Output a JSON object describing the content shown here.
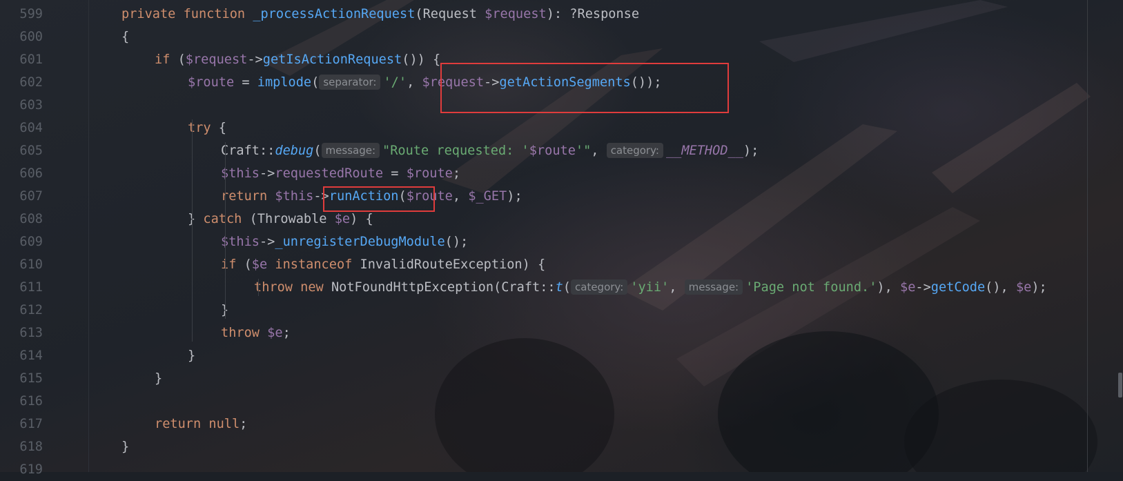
{
  "editor": {
    "lines": [
      {
        "n": "599",
        "indent": 1,
        "tokens": [
          {
            "t": "private ",
            "c": "kw"
          },
          {
            "t": "function ",
            "c": "kw"
          },
          {
            "t": "_processActionRequest",
            "c": "fn"
          },
          {
            "t": "(Request ",
            "c": ""
          },
          {
            "t": "$request",
            "c": "var"
          },
          {
            "t": "): ?Response",
            "c": ""
          }
        ]
      },
      {
        "n": "600",
        "indent": 1,
        "tokens": [
          {
            "t": "{",
            "c": ""
          }
        ]
      },
      {
        "n": "601",
        "indent": 2,
        "tokens": [
          {
            "t": "if ",
            "c": "kw"
          },
          {
            "t": "(",
            "c": ""
          },
          {
            "t": "$request",
            "c": "var"
          },
          {
            "t": "->",
            "c": ""
          },
          {
            "t": "getIsActionRequest",
            "c": "fn"
          },
          {
            "t": "()) {",
            "c": ""
          }
        ]
      },
      {
        "n": "602",
        "indent": 3,
        "tokens": [
          {
            "t": "$route",
            "c": "var"
          },
          {
            "t": " = ",
            "c": ""
          },
          {
            "t": "implode",
            "c": "fn"
          },
          {
            "t": "(",
            "c": ""
          },
          {
            "hint": "separator:"
          },
          {
            "t": "'/'",
            "c": "str"
          },
          {
            "t": ", ",
            "c": ""
          },
          {
            "t": "$request",
            "c": "var"
          },
          {
            "t": "->",
            "c": ""
          },
          {
            "t": "getActionSegments",
            "c": "fn"
          },
          {
            "t": "());",
            "c": ""
          }
        ]
      },
      {
        "n": "603",
        "indent": 0,
        "tokens": []
      },
      {
        "n": "604",
        "indent": 3,
        "tokens": [
          {
            "t": "try ",
            "c": "kw"
          },
          {
            "t": "{",
            "c": ""
          }
        ]
      },
      {
        "n": "605",
        "indent": 4,
        "tokens": [
          {
            "t": "Craft::",
            "c": ""
          },
          {
            "t": "debug",
            "c": "fn it"
          },
          {
            "t": "(",
            "c": ""
          },
          {
            "hint": "message:"
          },
          {
            "t": "\"Route requested: '",
            "c": "str"
          },
          {
            "t": "$route",
            "c": "var"
          },
          {
            "t": "'\"",
            "c": "str"
          },
          {
            "t": ", ",
            "c": ""
          },
          {
            "hint": "category:"
          },
          {
            "t": "__METHOD__",
            "c": "var it"
          },
          {
            "t": ");",
            "c": ""
          }
        ]
      },
      {
        "n": "606",
        "indent": 4,
        "tokens": [
          {
            "t": "$this",
            "c": "var"
          },
          {
            "t": "->",
            "c": ""
          },
          {
            "t": "requestedRoute",
            "c": "var"
          },
          {
            "t": " = ",
            "c": ""
          },
          {
            "t": "$route",
            "c": "var"
          },
          {
            "t": ";",
            "c": ""
          }
        ]
      },
      {
        "n": "607",
        "indent": 4,
        "tokens": [
          {
            "t": "return ",
            "c": "kw"
          },
          {
            "t": "$this",
            "c": "var"
          },
          {
            "t": "->",
            "c": ""
          },
          {
            "t": "runAction",
            "c": "fn"
          },
          {
            "t": "(",
            "c": ""
          },
          {
            "t": "$route",
            "c": "var"
          },
          {
            "t": ", ",
            "c": ""
          },
          {
            "t": "$_GET",
            "c": "var"
          },
          {
            "t": ");",
            "c": ""
          }
        ]
      },
      {
        "n": "608",
        "indent": 3,
        "tokens": [
          {
            "t": "} ",
            "c": ""
          },
          {
            "t": "catch ",
            "c": "kw"
          },
          {
            "t": "(Throwable ",
            "c": ""
          },
          {
            "t": "$e",
            "c": "var"
          },
          {
            "t": ") {",
            "c": ""
          }
        ]
      },
      {
        "n": "609",
        "indent": 4,
        "tokens": [
          {
            "t": "$this",
            "c": "var"
          },
          {
            "t": "->",
            "c": ""
          },
          {
            "t": "_unregisterDebugModule",
            "c": "fn"
          },
          {
            "t": "();",
            "c": ""
          }
        ]
      },
      {
        "n": "610",
        "indent": 4,
        "tokens": [
          {
            "t": "if ",
            "c": "kw"
          },
          {
            "t": "(",
            "c": ""
          },
          {
            "t": "$e ",
            "c": "var"
          },
          {
            "t": "instanceof ",
            "c": "kw"
          },
          {
            "t": "InvalidRouteException) {",
            "c": ""
          }
        ]
      },
      {
        "n": "611",
        "indent": 5,
        "tokens": [
          {
            "t": "throw ",
            "c": "kw"
          },
          {
            "t": "new ",
            "c": "kw"
          },
          {
            "t": "NotFoundHttpException(Craft::",
            "c": ""
          },
          {
            "t": "t",
            "c": "fn it"
          },
          {
            "t": "(",
            "c": ""
          },
          {
            "hint": "category:"
          },
          {
            "t": "'yii'",
            "c": "str"
          },
          {
            "t": ", ",
            "c": ""
          },
          {
            "hint": "message:"
          },
          {
            "t": "'Page not found.'",
            "c": "str"
          },
          {
            "t": "), ",
            "c": ""
          },
          {
            "t": "$e",
            "c": "var"
          },
          {
            "t": "->",
            "c": ""
          },
          {
            "t": "getCode",
            "c": "fn"
          },
          {
            "t": "(), ",
            "c": ""
          },
          {
            "t": "$e",
            "c": "var"
          },
          {
            "t": ");",
            "c": ""
          }
        ]
      },
      {
        "n": "612",
        "indent": 4,
        "tokens": [
          {
            "t": "}",
            "c": ""
          }
        ]
      },
      {
        "n": "613",
        "indent": 4,
        "tokens": [
          {
            "t": "throw ",
            "c": "kw"
          },
          {
            "t": "$e",
            "c": "var"
          },
          {
            "t": ";",
            "c": ""
          }
        ]
      },
      {
        "n": "614",
        "indent": 3,
        "tokens": [
          {
            "t": "}",
            "c": ""
          }
        ]
      },
      {
        "n": "615",
        "indent": 2,
        "tokens": [
          {
            "t": "}",
            "c": ""
          }
        ]
      },
      {
        "n": "616",
        "indent": 0,
        "tokens": []
      },
      {
        "n": "617",
        "indent": 2,
        "tokens": [
          {
            "t": "return ",
            "c": "kw"
          },
          {
            "t": "null",
            "c": "kw"
          },
          {
            "t": ";",
            "c": ""
          }
        ]
      },
      {
        "n": "618",
        "indent": 1,
        "tokens": [
          {
            "t": "}",
            "c": ""
          }
        ]
      },
      {
        "n": "619",
        "indent": 0,
        "tokens": []
      }
    ]
  },
  "annotations": [
    {
      "label": "highlight-getActionSegments"
    },
    {
      "label": "highlight-runAction"
    }
  ],
  "colors": {
    "keyword": "#cf8e6d",
    "function": "#56a8f5",
    "variable": "#9876aa",
    "string": "#6aab73",
    "text": "#bcbec4",
    "line_number": "#595e66",
    "highlight_box": "#e03c3c"
  }
}
